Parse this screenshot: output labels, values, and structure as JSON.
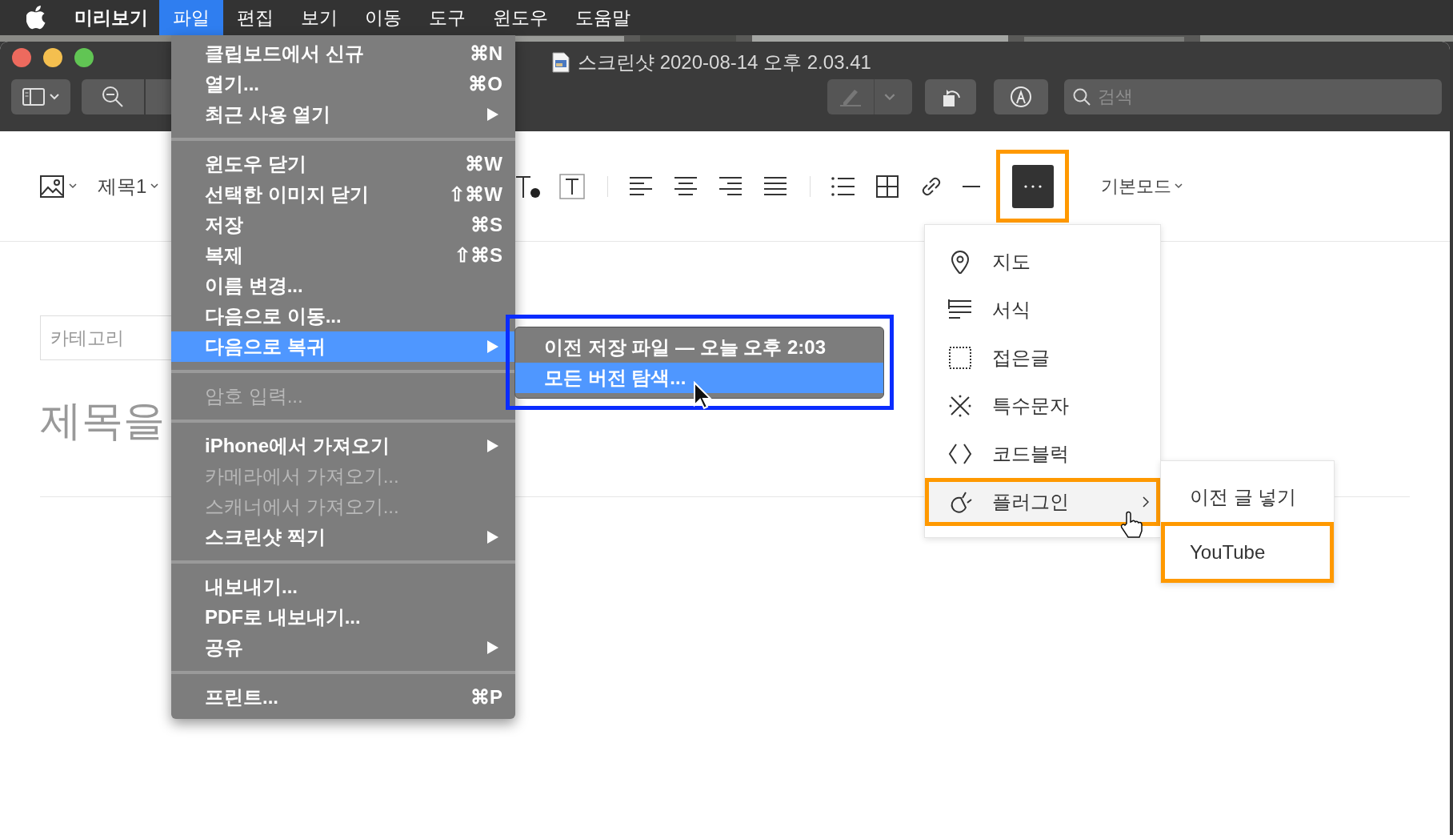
{
  "menu_bar": {
    "items": [
      {
        "label": "미리보기",
        "kind": "app",
        "selected": false
      },
      {
        "label": "파일",
        "kind": "menu",
        "selected": true
      },
      {
        "label": "편집",
        "kind": "menu",
        "selected": false
      },
      {
        "label": "보기",
        "kind": "menu",
        "selected": false
      },
      {
        "label": "이동",
        "kind": "menu",
        "selected": false
      },
      {
        "label": "도구",
        "kind": "menu",
        "selected": false
      },
      {
        "label": "윈도우",
        "kind": "menu",
        "selected": false
      },
      {
        "label": "도움말",
        "kind": "menu",
        "selected": false
      }
    ]
  },
  "window": {
    "title": "스크린샷 2020-08-14 오후 2.03.41",
    "search_placeholder": "검색"
  },
  "editor": {
    "heading": "제목1",
    "mode": "기본모드",
    "more_button": {
      "framed": true
    },
    "category_placeholder": "카테고리",
    "title_placeholder": "제목을"
  },
  "file_menu": [
    {
      "kind": "item",
      "label": "클립보드에서 신규",
      "shortcut": "⌘N",
      "submenu": false,
      "disabled": false,
      "selected": false
    },
    {
      "kind": "item",
      "label": "열기...",
      "shortcut": "⌘O",
      "submenu": false,
      "disabled": false,
      "selected": false
    },
    {
      "kind": "item",
      "label": "최근 사용 열기",
      "submenu": true,
      "disabled": false,
      "selected": false
    },
    {
      "kind": "separator"
    },
    {
      "kind": "item",
      "label": "윈도우 닫기",
      "shortcut": "⌘W",
      "submenu": false,
      "disabled": false,
      "selected": false
    },
    {
      "kind": "item",
      "label": "선택한 이미지 닫기",
      "shortcut": "⇧⌘W",
      "submenu": false,
      "disabled": false,
      "selected": false
    },
    {
      "kind": "item",
      "label": "저장",
      "shortcut": "⌘S",
      "submenu": false,
      "disabled": false,
      "selected": false
    },
    {
      "kind": "item",
      "label": "복제",
      "shortcut": "⇧⌘S",
      "submenu": false,
      "disabled": false,
      "selected": false
    },
    {
      "kind": "item",
      "label": "이름 변경...",
      "submenu": false,
      "disabled": false,
      "selected": false
    },
    {
      "kind": "item",
      "label": "다음으로 이동...",
      "submenu": false,
      "disabled": false,
      "selected": false
    },
    {
      "kind": "item",
      "label": "다음으로 복귀",
      "submenu": true,
      "disabled": false,
      "selected": true
    },
    {
      "kind": "separator"
    },
    {
      "kind": "item",
      "label": "암호 입력...",
      "submenu": false,
      "disabled": true,
      "selected": false
    },
    {
      "kind": "separator"
    },
    {
      "kind": "item",
      "label": "iPhone에서 가져오기",
      "submenu": true,
      "disabled": false,
      "selected": false
    },
    {
      "kind": "item",
      "label": "카메라에서 가져오기...",
      "submenu": false,
      "disabled": true,
      "selected": false
    },
    {
      "kind": "item",
      "label": "스캐너에서 가져오기...",
      "submenu": false,
      "disabled": true,
      "selected": false
    },
    {
      "kind": "item",
      "label": "스크린샷 찍기",
      "submenu": true,
      "disabled": false,
      "selected": false
    },
    {
      "kind": "separator"
    },
    {
      "kind": "item",
      "label": "내보내기...",
      "submenu": false,
      "disabled": false,
      "selected": false
    },
    {
      "kind": "item",
      "label": "PDF로 내보내기...",
      "submenu": false,
      "disabled": false,
      "selected": false
    },
    {
      "kind": "item",
      "label": "공유",
      "submenu": true,
      "disabled": false,
      "selected": false
    },
    {
      "kind": "separator"
    },
    {
      "kind": "item",
      "label": "프린트...",
      "shortcut": "⌘P",
      "submenu": false,
      "disabled": false,
      "selected": false
    }
  ],
  "revert_submenu": {
    "framed": true,
    "items": [
      {
        "label": "이전 저장 파일 — 오늘 오후 2:03",
        "selected": false
      },
      {
        "label": "모든 버전 탐색...",
        "selected": true
      }
    ]
  },
  "more_menu": [
    {
      "kind": "pin",
      "label": "지도",
      "selected": false,
      "framed": false,
      "submenu": false
    },
    {
      "kind": "lines",
      "label": "서식",
      "selected": false,
      "framed": false,
      "submenu": false
    },
    {
      "kind": "dotted-box",
      "label": "접은글",
      "selected": false,
      "framed": false,
      "submenu": false
    },
    {
      "kind": "asterisk",
      "label": "특수문자",
      "selected": false,
      "framed": false,
      "submenu": false
    },
    {
      "kind": "code",
      "label": "코드블럭",
      "selected": false,
      "framed": false,
      "submenu": false
    },
    {
      "kind": "plug",
      "label": "플러그인",
      "selected": true,
      "framed": true,
      "submenu": true
    }
  ],
  "plugin_submenu": [
    {
      "label": "이전 글 넣기",
      "framed": false
    },
    {
      "label": "YouTube",
      "framed": true
    }
  ]
}
